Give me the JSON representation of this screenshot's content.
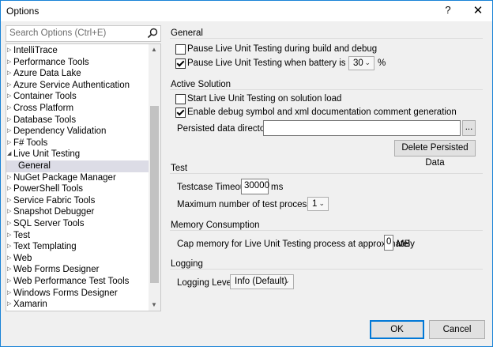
{
  "window": {
    "title": "Options",
    "help_glyph": "?",
    "close_glyph": "✕"
  },
  "search": {
    "placeholder": "Search Options (Ctrl+E)"
  },
  "tree": {
    "items": [
      {
        "label": "IntelliTrace",
        "expanded": false
      },
      {
        "label": "Performance Tools",
        "expanded": false
      },
      {
        "label": "Azure Data Lake",
        "expanded": false
      },
      {
        "label": "Azure Service Authentication",
        "expanded": false
      },
      {
        "label": "Container Tools",
        "expanded": false
      },
      {
        "label": "Cross Platform",
        "expanded": false
      },
      {
        "label": "Database Tools",
        "expanded": false
      },
      {
        "label": "Dependency Validation",
        "expanded": false
      },
      {
        "label": "F# Tools",
        "expanded": false
      },
      {
        "label": "Live Unit Testing",
        "expanded": true
      },
      {
        "label": "General",
        "child": true,
        "selected": true
      },
      {
        "label": "NuGet Package Manager",
        "expanded": false
      },
      {
        "label": "PowerShell Tools",
        "expanded": false
      },
      {
        "label": "Service Fabric Tools",
        "expanded": false
      },
      {
        "label": "Snapshot Debugger",
        "expanded": false
      },
      {
        "label": "SQL Server Tools",
        "expanded": false
      },
      {
        "label": "Test",
        "expanded": false
      },
      {
        "label": "Text Templating",
        "expanded": false
      },
      {
        "label": "Web",
        "expanded": false
      },
      {
        "label": "Web Forms Designer",
        "expanded": false
      },
      {
        "label": "Web Performance Test Tools",
        "expanded": false
      },
      {
        "label": "Windows Forms Designer",
        "expanded": false
      },
      {
        "label": "Xamarin",
        "expanded": false
      }
    ]
  },
  "general": {
    "title": "General",
    "pause_build_label": "Pause Live Unit Testing during build and debug",
    "pause_build_checked": false,
    "pause_battery_label": "Pause Live Unit Testing when battery is below:",
    "pause_battery_checked": true,
    "battery_value": "30",
    "battery_unit": "%"
  },
  "active_solution": {
    "title": "Active Solution",
    "start_label": "Start Live Unit Testing on solution load",
    "start_checked": false,
    "debug_symbol_label": "Enable debug symbol and xml documentation comment generation",
    "debug_symbol_checked": true,
    "persisted_label": "Persisted data directory:",
    "persisted_value": "",
    "browse_label": "...",
    "delete_label": "Delete Persisted Data"
  },
  "test": {
    "title": "Test",
    "timeout_label": "Testcase Timeout:",
    "timeout_value": "30000",
    "timeout_unit": "ms",
    "max_proc_label": "Maximum number of test processes:",
    "max_proc_value": "1"
  },
  "memory": {
    "title": "Memory Consumption",
    "cap_label": "Cap memory for Live Unit Testing process at approximately",
    "cap_value": "0",
    "cap_unit": "MB"
  },
  "logging": {
    "title": "Logging",
    "level_label": "Logging Level:",
    "level_value": "Info (Default)"
  },
  "buttons": {
    "ok": "OK",
    "cancel": "Cancel"
  }
}
